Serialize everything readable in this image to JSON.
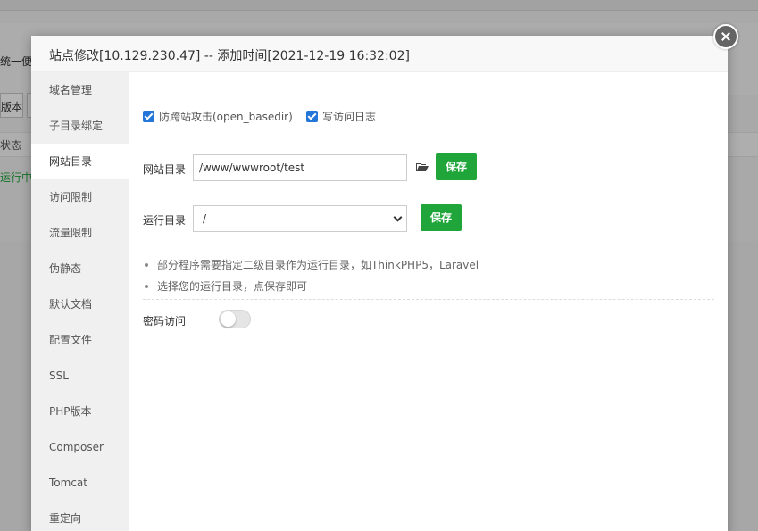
{
  "background": {
    "system_text": "统一便",
    "button_text": "版本",
    "status_header": "状态",
    "running_text": "运行中"
  },
  "dialog": {
    "title": "站点修改[10.129.230.47] -- 添加时间[2021-12-19 16:32:02]",
    "close_icon": "close-icon"
  },
  "sidebar": {
    "items": [
      {
        "label": "域名管理",
        "active": false
      },
      {
        "label": "子目录绑定",
        "active": false
      },
      {
        "label": "网站目录",
        "active": true
      },
      {
        "label": "访问限制",
        "active": false
      },
      {
        "label": "流量限制",
        "active": false
      },
      {
        "label": "伪静态",
        "active": false
      },
      {
        "label": "默认文档",
        "active": false
      },
      {
        "label": "配置文件",
        "active": false
      },
      {
        "label": "SSL",
        "active": false
      },
      {
        "label": "PHP版本",
        "active": false
      },
      {
        "label": "Composer",
        "active": false
      },
      {
        "label": "Tomcat",
        "active": false
      },
      {
        "label": "重定向",
        "active": false
      }
    ]
  },
  "content": {
    "checkbox_open_basedir": {
      "label": "防跨站攻击(open_basedir)",
      "checked": true
    },
    "checkbox_access_log": {
      "label": "写访问日志",
      "checked": true
    },
    "site_dir": {
      "label": "网站目录",
      "value": "/www/wwwroot/test",
      "save_label": "保存"
    },
    "run_dir": {
      "label": "运行目录",
      "value": "/",
      "save_label": "保存"
    },
    "tips": [
      "部分程序需要指定二级目录作为运行目录，如ThinkPHP5，Laravel",
      "选择您的运行目录，点保存即可"
    ],
    "password_access": {
      "label": "密码访问",
      "enabled": false
    }
  },
  "colors": {
    "accent_green": "#20a53a",
    "checkbox_blue": "#2476d8"
  }
}
